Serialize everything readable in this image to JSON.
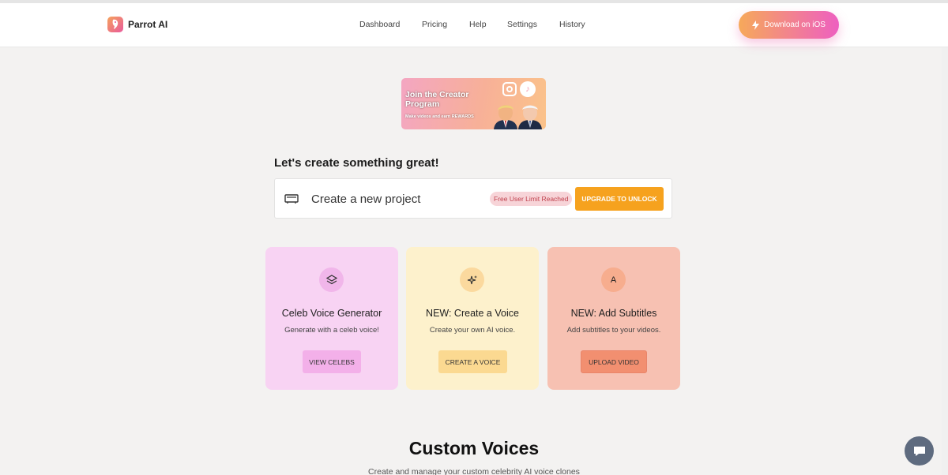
{
  "header": {
    "logo_text": "Parrot AI",
    "nav": [
      "Dashboard",
      "Pricing",
      "Help",
      "Settings",
      "History"
    ],
    "download_label": "Download on iOS"
  },
  "banner": {
    "title": "Join the Creator Program",
    "subtitle": "Make videos and earn REWARDS"
  },
  "main": {
    "headline": "Let's create something great!",
    "project_label": "Create a new project",
    "limit_badge": "Free User Limit Reached",
    "upgrade_label": "UPGRADE TO UNLOCK"
  },
  "cards": [
    {
      "title": "Celeb Voice Generator",
      "desc": "Generate with a celeb voice!",
      "button": "VIEW CELEBS",
      "icon": "layers-icon",
      "color": "#f8d3f3"
    },
    {
      "title": "NEW: Create a Voice",
      "desc": "Create your own AI voice.",
      "button": "CREATE A VOICE",
      "icon": "sparkles-icon",
      "color": "#fdf1cc"
    },
    {
      "title": "NEW: Add Subtitles",
      "desc": "Add subtitles to your videos.",
      "button": "UPLOAD VIDEO",
      "icon_letter": "A",
      "color": "#f7c1b2"
    }
  ],
  "custom_voices": {
    "title": "Custom Voices",
    "subtitle": "Create and manage your custom celebrity AI voice clones"
  },
  "colors": {
    "accent_orange": "#f6a21e",
    "download_gradient": [
      "#f6a95a",
      "#ee5fc0"
    ]
  }
}
